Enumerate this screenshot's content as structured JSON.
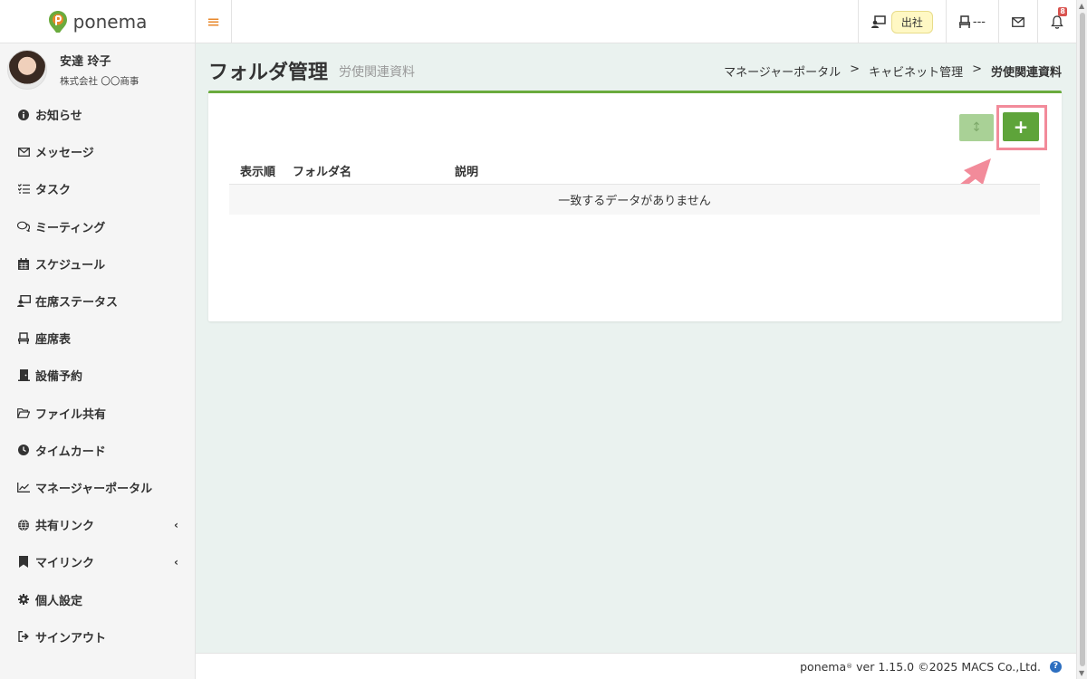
{
  "app": {
    "logo_text": "ponema",
    "brand_color": "#6aab3d",
    "accent_color": "#e8872a"
  },
  "topbar": {
    "attendance_status": "出社",
    "seat_status": "---",
    "notification_count": "8"
  },
  "user": {
    "name": "安達 玲子",
    "company": "株式会社 〇〇商事"
  },
  "sidebar": {
    "items": [
      {
        "label": "お知らせ",
        "icon": "info-circle-icon"
      },
      {
        "label": "メッセージ",
        "icon": "envelope-icon"
      },
      {
        "label": "タスク",
        "icon": "task-list-icon"
      },
      {
        "label": "ミーティング",
        "icon": "chat-bubbles-icon"
      },
      {
        "label": "スケジュール",
        "icon": "calendar-icon"
      },
      {
        "label": "在席ステータス",
        "icon": "presence-icon"
      },
      {
        "label": "座席表",
        "icon": "chair-icon"
      },
      {
        "label": "設備予約",
        "icon": "door-icon"
      },
      {
        "label": "ファイル共有",
        "icon": "folder-open-icon"
      },
      {
        "label": "タイムカード",
        "icon": "clock-icon"
      },
      {
        "label": "マネージャーポータル",
        "icon": "chart-line-icon"
      },
      {
        "label": "共有リンク",
        "icon": "globe-icon"
      },
      {
        "label": "マイリンク",
        "icon": "bookmark-icon"
      },
      {
        "label": "個人設定",
        "icon": "gear-icon"
      },
      {
        "label": "サインアウト",
        "icon": "sign-out-icon"
      }
    ]
  },
  "page": {
    "title": "フォルダ管理",
    "subtitle": "労使関連資料",
    "breadcrumb": [
      "マネージャーポータル",
      "キャビネット管理",
      "労使関連資料"
    ],
    "breadcrumb_separator": ">"
  },
  "table": {
    "columns": [
      "表示順",
      "フォルダ名",
      "説明"
    ],
    "empty_message": "一致するデータがありません"
  },
  "buttons": {
    "sort_icon": "↕",
    "add_icon": "+"
  },
  "footer": {
    "product": "ponema",
    "version_text": "ver 1.15.0 ©2025 MACS Co.,Ltd.",
    "help": "?"
  }
}
